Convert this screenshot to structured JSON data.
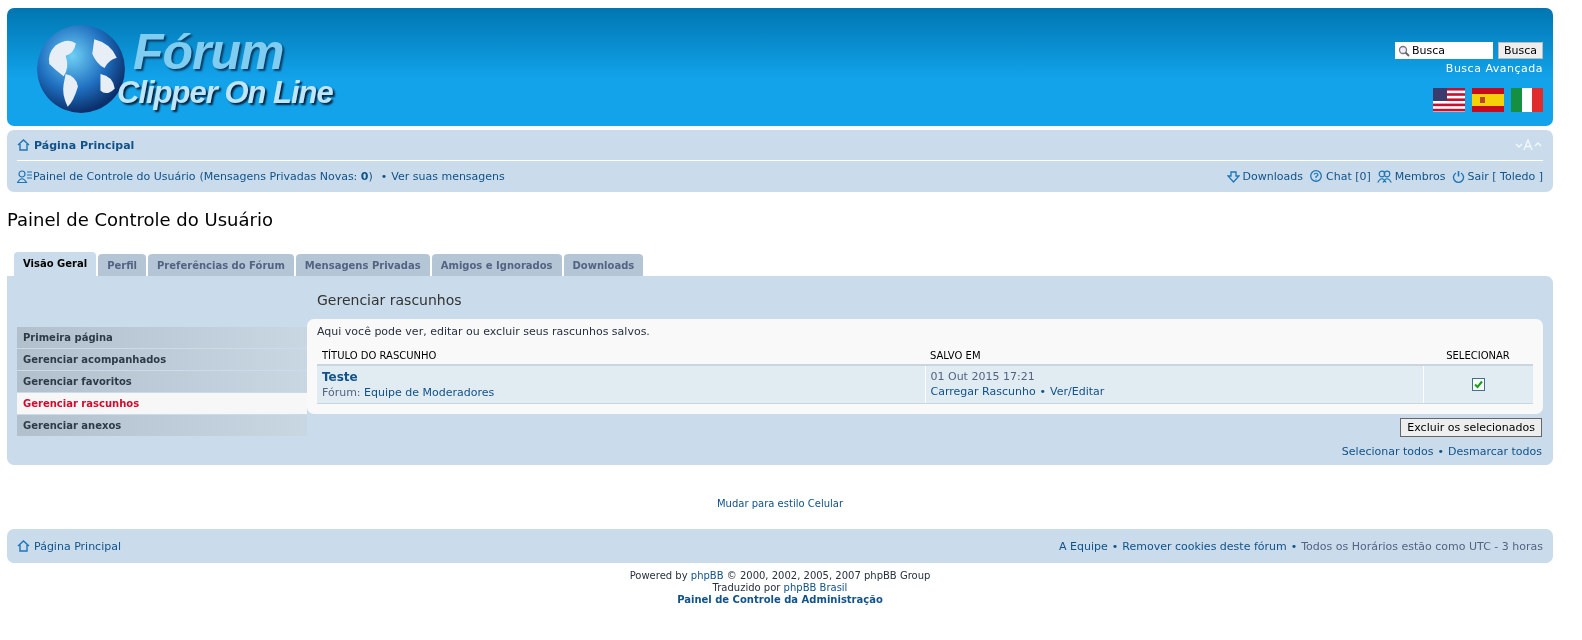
{
  "header": {
    "logo": {
      "title": "Fórum",
      "subtitle": "Clipper On Line"
    },
    "search": {
      "value": "Busca",
      "button": "Busca",
      "advanced_link": "Busca Avançada"
    }
  },
  "navbar": {
    "home_link": "Página Principal",
    "ucp_link": "Painel de Controle do Usuário",
    "pm_status": "(Mensagens Privadas Novas: **0**)",
    "separator": "•",
    "view_messages_link": "Ver suas mensagens",
    "links": [
      {
        "kind": "download",
        "label": "Downloads"
      },
      {
        "kind": "chat",
        "label": "Chat [0]"
      },
      {
        "kind": "members",
        "label": "Membros"
      },
      {
        "kind": "logout",
        "label": "Sair [ Toledo ]"
      }
    ]
  },
  "page_title": "Painel de Controle do Usuário",
  "tabs": [
    {
      "label": "Visão Geral",
      "selected": true
    },
    {
      "label": "Perfil",
      "selected": false
    },
    {
      "label": "Preferências do Fórum",
      "selected": false
    },
    {
      "label": "Mensagens Privadas",
      "selected": false
    },
    {
      "label": "Amigos e Ignorados",
      "selected": false
    },
    {
      "label": "Downloads",
      "selected": false
    }
  ],
  "sidebar": {
    "items": [
      {
        "label": "Primeira página",
        "selected": false
      },
      {
        "label": "Gerenciar acompanhados",
        "selected": false
      },
      {
        "label": "Gerenciar favoritos",
        "selected": false
      },
      {
        "label": "Gerenciar rascunhos",
        "selected": true
      },
      {
        "label": "Gerenciar anexos",
        "selected": false
      }
    ]
  },
  "panel": {
    "title": "Gerenciar rascunhos",
    "description": "Aqui você pode ver, editar ou excluir seus rascunhos salvos.",
    "table": {
      "columns": [
        "TÍTULO DO RASCUNHO",
        "SALVO EM",
        "SELECIONAR"
      ],
      "rows": [
        {
          "title": "Teste",
          "forum_label": "Fórum:",
          "forum": "Equipe de Moderadores",
          "saved": "01 Out 2015 17:21",
          "actions": [
            "Carregar Rascunho",
            "Ver/Editar"
          ],
          "action_separator": "•",
          "checked": true
        }
      ]
    },
    "delete_button": "Excluir os selecionados",
    "select_links": [
      "Selecionar todos",
      "Desmarcar todos"
    ],
    "select_separator": "•"
  },
  "style_switch_link": "Mudar para estilo Celular",
  "footer": {
    "home_link": "Página Principal",
    "links": [
      "A Equipe",
      "Remover cookies deste fórum"
    ],
    "separator": "•",
    "timezone": "Todos os Horários estão como UTC - 3 horas"
  },
  "credits": {
    "lines": [
      {
        "before": "Powered by ",
        "link": "phpBB",
        "after": " © 2000, 2002, 2005, 2007 phpBB Group"
      },
      {
        "before": "Traduzido por ",
        "link": "phpBB Brasil"
      }
    ],
    "admin_link": "Painel de Controle da Administração"
  }
}
